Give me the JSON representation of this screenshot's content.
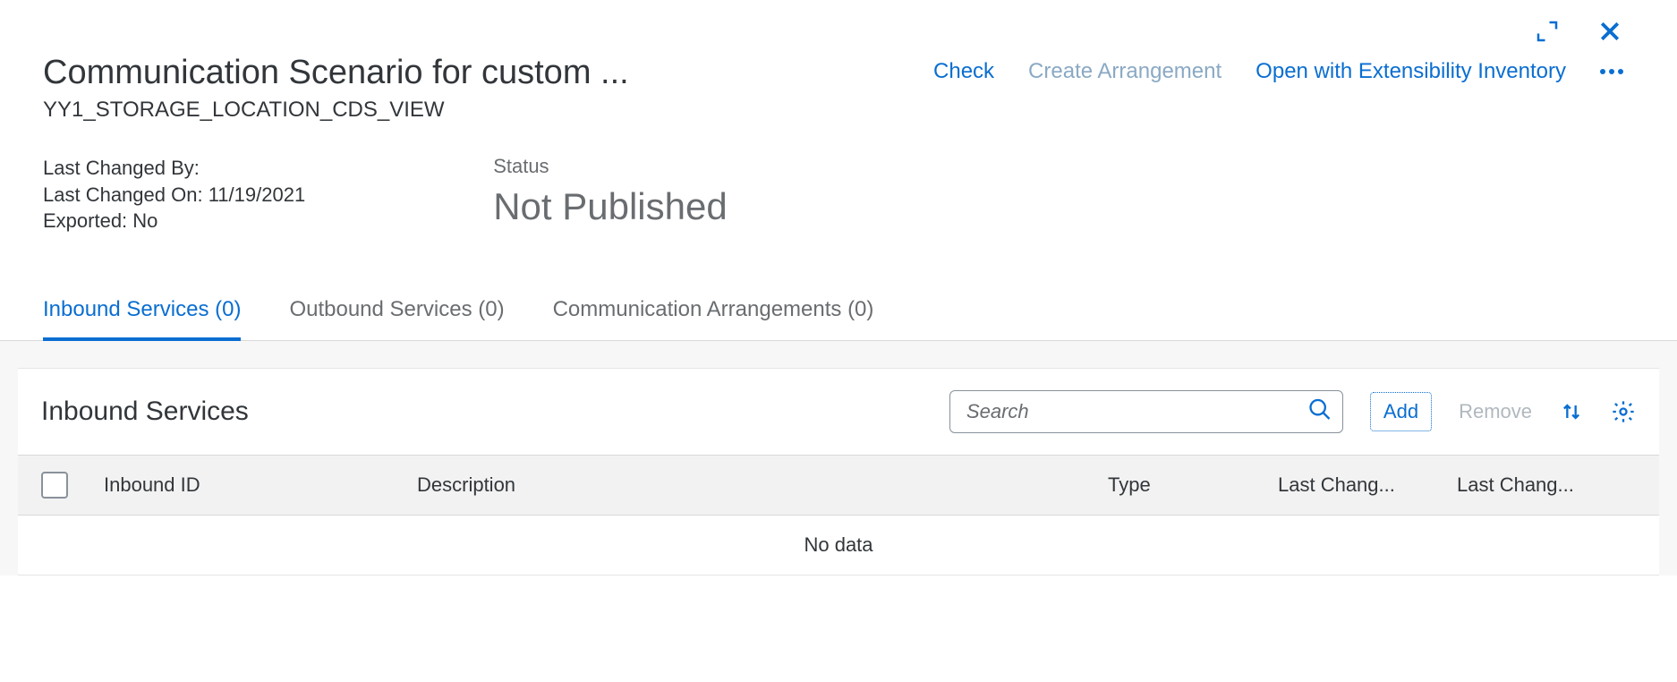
{
  "header": {
    "title": "Communication Scenario for custom ...",
    "subtitle": "YY1_STORAGE_LOCATION_CDS_VIEW",
    "actions": {
      "check": "Check",
      "create_arrangement": "Create Arrangement",
      "open_ext_inventory": "Open with Extensibility Inventory"
    }
  },
  "info": {
    "last_changed_by_label": "Last Changed By:",
    "last_changed_on_label": "Last Changed On:",
    "last_changed_on_value": "11/19/2021",
    "exported_label": "Exported:",
    "exported_value": "No",
    "status_label": "Status",
    "status_value": "Not Published"
  },
  "tabs": {
    "inbound": "Inbound Services (0)",
    "outbound": "Outbound Services (0)",
    "comm_arr": "Communication Arrangements (0)"
  },
  "section": {
    "title": "Inbound Services",
    "search_placeholder": "Search",
    "add_label": "Add",
    "remove_label": "Remove"
  },
  "columns": {
    "inbound_id": "Inbound ID",
    "description": "Description",
    "type": "Type",
    "last_changed_by": "Last Chang...",
    "last_changed_on": "Last Chang..."
  },
  "table": {
    "no_data": "No data"
  }
}
